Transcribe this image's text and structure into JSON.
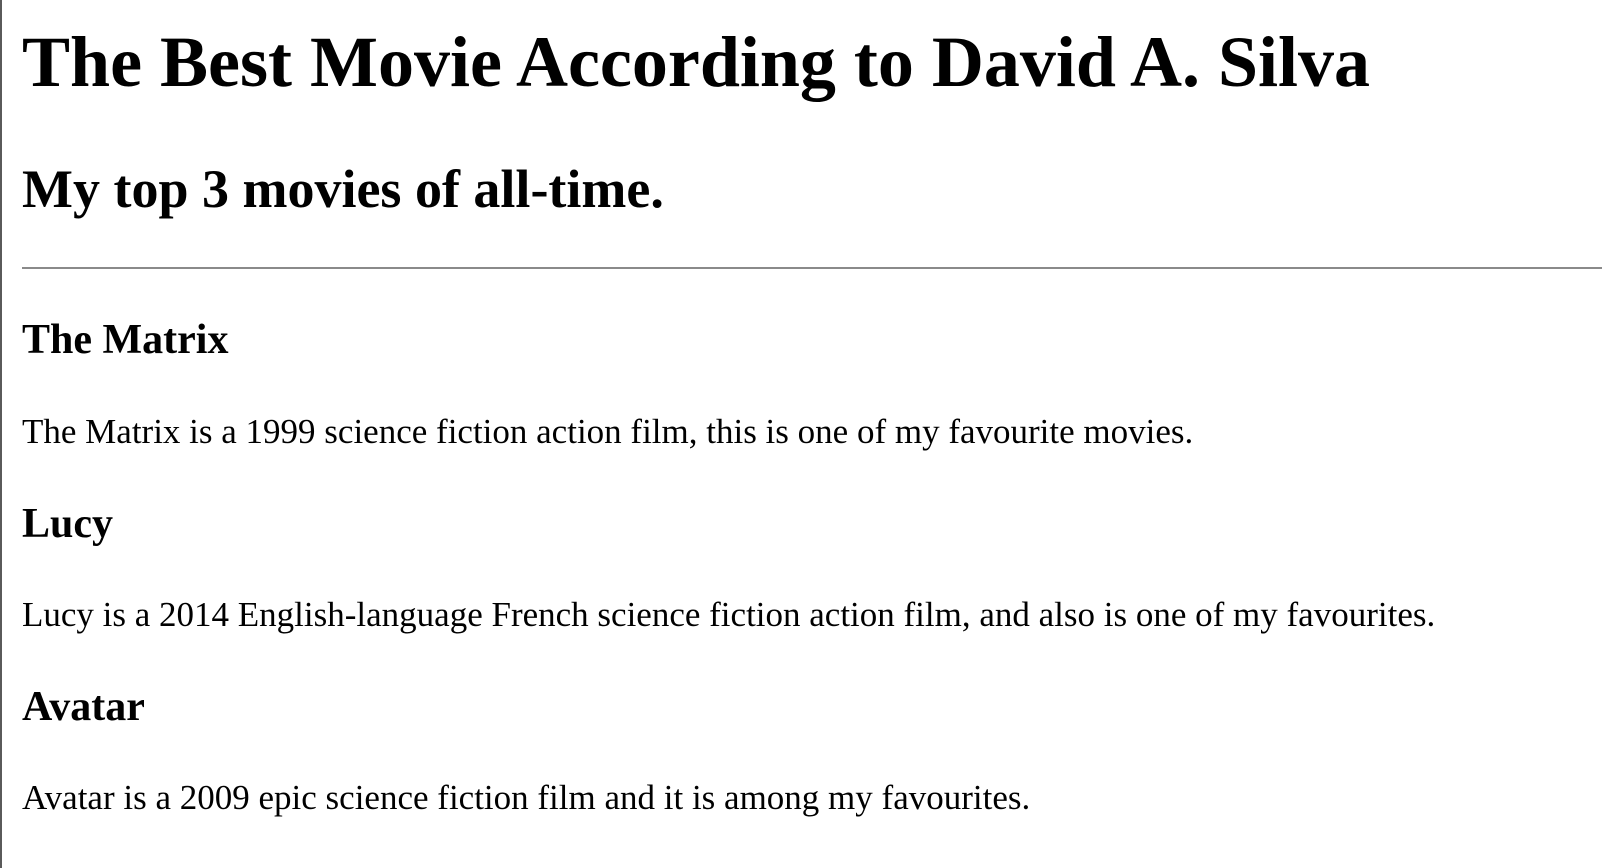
{
  "header": {
    "title": "The Best Movie According to David A. Silva",
    "subtitle": "My top 3 movies of all-time."
  },
  "movies": [
    {
      "title": "The Matrix",
      "description": "The Matrix is a 1999 science fiction action film, this is one of my favourite movies."
    },
    {
      "title": "Lucy",
      "description": "Lucy is a 2014 English-language French science fiction action film, and also is one of my favourites."
    },
    {
      "title": "Avatar",
      "description": "Avatar is a 2009 epic science fiction film and it is among my favourites."
    }
  ]
}
